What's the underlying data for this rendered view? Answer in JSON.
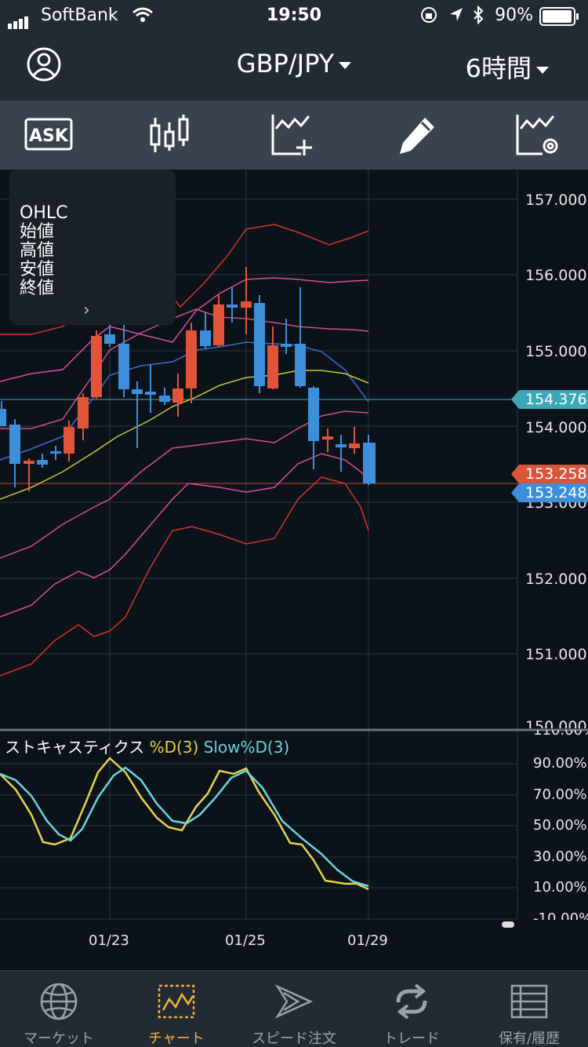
{
  "status_bar": {
    "carrier": "SoftBank",
    "time": "19:50",
    "battery": "90%"
  },
  "header": {
    "pair": "GBP/JPY",
    "timeframe": "6時間"
  },
  "toolbar": {
    "ask_label": "ASK",
    "tools": [
      "candlestick-icon",
      "add-indicator-icon",
      "draw-pencil-icon",
      "indicator-settings-icon"
    ]
  },
  "ohlc_panel": {
    "lines": [
      "OHLC",
      "始値",
      "高値",
      "安値",
      "終値"
    ],
    "expand": "›"
  },
  "price_axis": [
    "157.000",
    "156.000",
    "155.000",
    "154.000",
    "153.000",
    "152.000",
    "151.000",
    "150.000"
  ],
  "price_tags": {
    "line": "154.376",
    "bid": "153.258",
    "ask": "153.248"
  },
  "stochastics": {
    "title": "ストキャスティクス",
    "series_d": "%D(3)",
    "series_slow": "Slow%D(3)",
    "axis": [
      "110.00%",
      "90.00%",
      "70.00%",
      "50.00%",
      "30.00%",
      "10.00%",
      "-10.00%"
    ]
  },
  "dates": [
    "01/23",
    "01/25",
    "01/29"
  ],
  "tabs": [
    {
      "label": "マーケット",
      "icon": "globe-icon",
      "active": false
    },
    {
      "label": "チャート",
      "icon": "chart-icon",
      "active": true
    },
    {
      "label": "スピード注文",
      "icon": "speed-order-icon",
      "active": false
    },
    {
      "label": "トレード",
      "icon": "trade-icon",
      "active": false
    },
    {
      "label": "保有/履歴",
      "icon": "history-icon",
      "active": false
    }
  ],
  "colors": {
    "up": "#e2543a",
    "down": "#3d8fd9",
    "accent": "#f2b23b",
    "stoch_d": "#e6d34a",
    "stoch_slow": "#6ad6e0"
  }
}
